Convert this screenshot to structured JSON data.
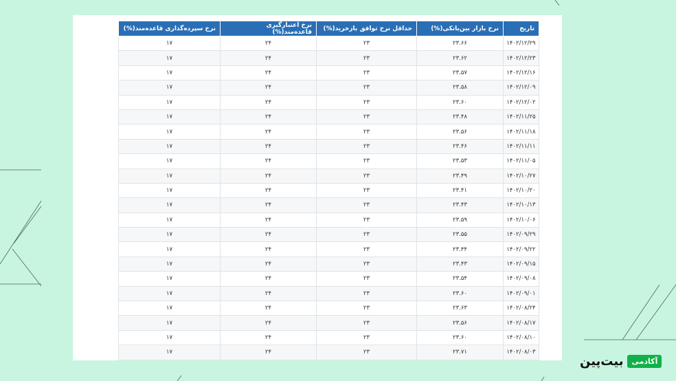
{
  "table": {
    "headers": [
      "تاریخ",
      "نرخ بازار بین‌بانکی(%)",
      "حداقل نرخ توافق بازخرید(%)",
      "نرخ اعتبارگیری قاعده‌مند(%)",
      "نرخ سپرده‌گذاری قاعده‌مند(%)"
    ],
    "rows": [
      [
        "۱۴۰۲/۱۲/۲۹",
        "۲۳.۶۶",
        "۲۳",
        "۲۴",
        "۱۷"
      ],
      [
        "۱۴۰۲/۱۲/۲۳",
        "۲۳.۶۲",
        "۲۳",
        "۲۴",
        "۱۷"
      ],
      [
        "۱۴۰۲/۱۲/۱۶",
        "۲۳.۵۷",
        "۲۳",
        "۲۴",
        "۱۷"
      ],
      [
        "۱۴۰۲/۱۲/۰۹",
        "۲۳.۵۸",
        "۲۳",
        "۲۴",
        "۱۷"
      ],
      [
        "۱۴۰۲/۱۲/۰۲",
        "۲۳.۶۰",
        "۲۳",
        "۲۴",
        "۱۷"
      ],
      [
        "۱۴۰۲/۱۱/۲۵",
        "۲۳.۴۸",
        "۲۳",
        "۲۴",
        "۱۷"
      ],
      [
        "۱۴۰۲/۱۱/۱۸",
        "۲۳.۵۶",
        "۲۳",
        "۲۴",
        "۱۷"
      ],
      [
        "۱۴۰۲/۱۱/۱۱",
        "۲۳.۴۶",
        "۲۳",
        "۲۴",
        "۱۷"
      ],
      [
        "۱۴۰۲/۱۱/۰۵",
        "۲۳.۵۳",
        "۲۳",
        "۲۴",
        "۱۷"
      ],
      [
        "۱۴۰۲/۱۰/۲۷",
        "۲۳.۴۹",
        "۲۳",
        "۲۴",
        "۱۷"
      ],
      [
        "۱۴۰۲/۱۰/۲۰",
        "۲۳.۴۱",
        "۲۳",
        "۲۴",
        "۱۷"
      ],
      [
        "۱۴۰۲/۱۰/۱۳",
        "۲۳.۴۳",
        "۲۳",
        "۲۴",
        "۱۷"
      ],
      [
        "۱۴۰۲/۱۰/۰۶",
        "۲۳.۵۹",
        "۲۳",
        "۲۴",
        "۱۷"
      ],
      [
        "۱۴۰۲/۰۹/۲۹",
        "۲۳.۵۵",
        "۲۳",
        "۲۴",
        "۱۷"
      ],
      [
        "۱۴۰۲/۰۹/۲۲",
        "۲۳.۴۴",
        "۲۳",
        "۲۴",
        "۱۷"
      ],
      [
        "۱۴۰۲/۰۹/۱۵",
        "۲۳.۴۳",
        "۲۳",
        "۲۴",
        "۱۷"
      ],
      [
        "۱۴۰۲/۰۹/۰۸",
        "۲۳.۵۴",
        "۲۳",
        "۲۴",
        "۱۷"
      ],
      [
        "۱۴۰۲/۰۹/۰۱",
        "۲۳.۶۰",
        "۲۳",
        "۲۴",
        "۱۷"
      ],
      [
        "۱۴۰۲/۰۸/۲۴",
        "۲۳.۶۳",
        "۲۳",
        "۲۴",
        "۱۷"
      ],
      [
        "۱۴۰۲/۰۸/۱۷",
        "۲۳.۵۶",
        "۲۳",
        "۲۴",
        "۱۷"
      ],
      [
        "۱۴۰۲/۰۸/۱۰",
        "۲۳.۶۰",
        "۲۳",
        "۲۴",
        "۱۷"
      ],
      [
        "۱۴۰۲/۰۸/۰۳",
        "۲۳.۷۱",
        "۲۳",
        "۲۴",
        "۱۷"
      ]
    ]
  },
  "brand": {
    "badge": "آکادمی",
    "name": "بیت‌پین",
    "badge_color": "#12b04a"
  },
  "colors": {
    "background": "#c8f5df",
    "header": "#2a6fb5"
  }
}
